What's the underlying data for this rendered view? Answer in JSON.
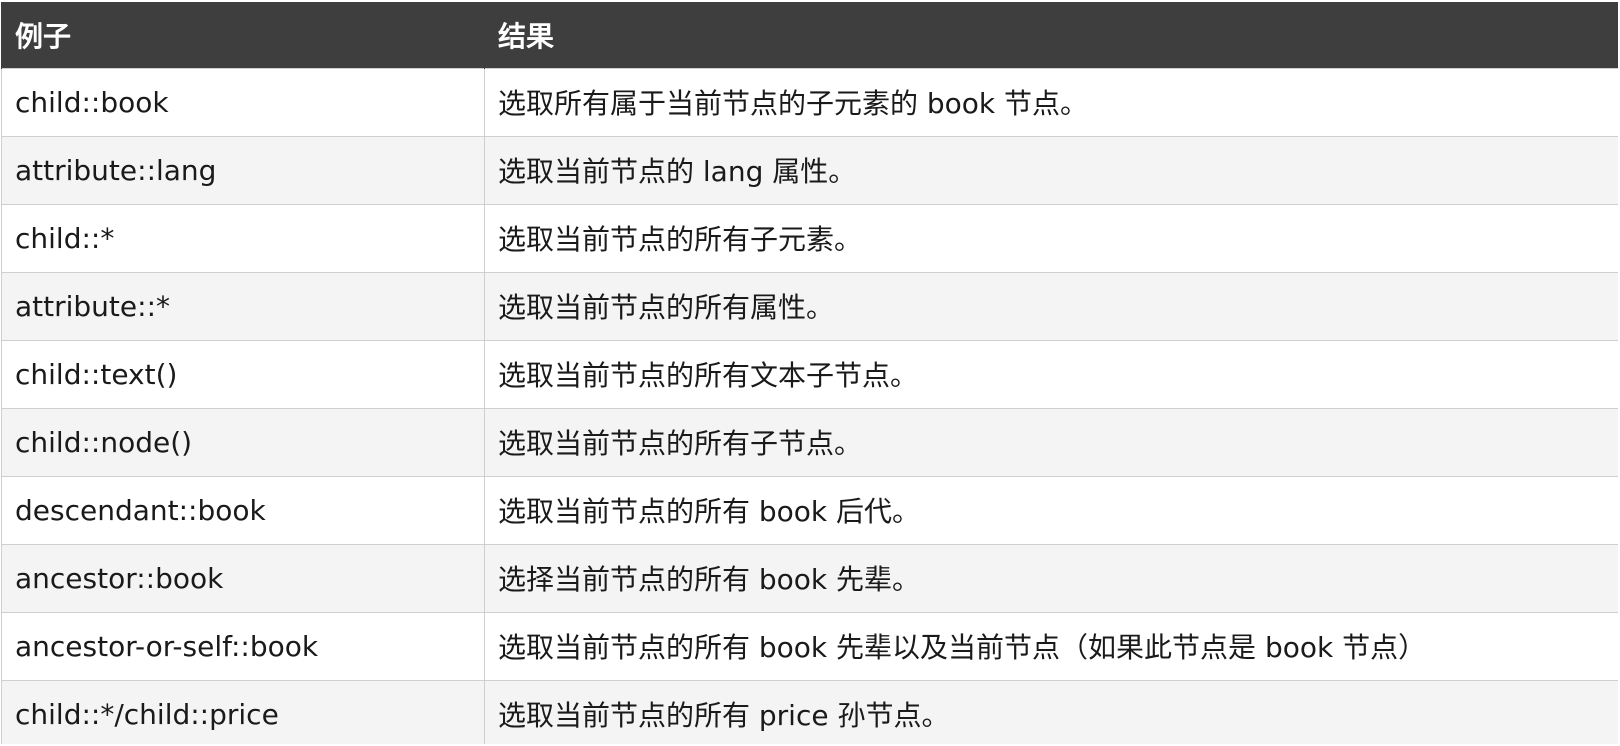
{
  "table": {
    "headers": [
      "例子",
      "结果"
    ],
    "rows": [
      {
        "example": "child::book",
        "result": "选取所有属于当前节点的子元素的 book 节点。"
      },
      {
        "example": "attribute::lang",
        "result": "选取当前节点的 lang 属性。"
      },
      {
        "example": "child::*",
        "result": "选取当前节点的所有子元素。"
      },
      {
        "example": "attribute::*",
        "result": "选取当前节点的所有属性。"
      },
      {
        "example": "child::text()",
        "result": "选取当前节点的所有文本子节点。"
      },
      {
        "example": "child::node()",
        "result": "选取当前节点的所有子节点。"
      },
      {
        "example": "descendant::book",
        "result": "选取当前节点的所有 book 后代。"
      },
      {
        "example": "ancestor::book",
        "result": "选择当前节点的所有 book 先辈。"
      },
      {
        "example": "ancestor-or-self::book",
        "result": "选取当前节点的所有 book 先辈以及当前节点（如果此节点是 book 节点）"
      },
      {
        "example": "child::*/child::price",
        "result": "选取当前节点的所有 price 孙节点。"
      }
    ]
  },
  "colors": {
    "header_bg": "#3e3e3e",
    "header_text": "#ffffff",
    "row_alt_bg": "#f4f4f4",
    "border": "#cfcfcf"
  }
}
